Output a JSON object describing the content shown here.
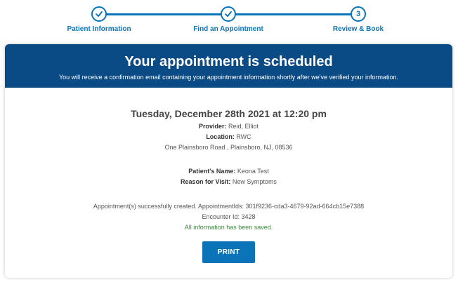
{
  "stepper": {
    "steps": [
      {
        "label": "Patient Information",
        "marker": "✓",
        "state": "complete"
      },
      {
        "label": "Find an Appointment",
        "marker": "✓",
        "state": "complete"
      },
      {
        "label": "Review & Book",
        "marker": "3",
        "state": "current"
      }
    ],
    "accent_color": "#0b74b8"
  },
  "header": {
    "title": "Your appointment is scheduled",
    "subtitle": "You will receive a confirmation email containing your appointment information shortly after we've verified your information.",
    "background_color": "#0a4a85"
  },
  "appointment": {
    "datetime": "Tuesday, December 28th 2021 at 12:20 pm",
    "provider_label": "Provider:",
    "provider": "Reid, Elliot",
    "location_label": "Location:",
    "location": "RWC",
    "address": "One Plainsboro Road , Plainsboro, NJ, 08536",
    "patient_label": "Patient's Name:",
    "patient": "Keona Test",
    "reason_label": "Reason for Visit:",
    "reason": "New Symptoms",
    "status_line": "Appointment(s) successfully created. AppointmentIds: 301f9236-cda3-4679-92ad-664cb15e7388",
    "encounter_line": "Encounter Id: 3428",
    "saved_line": "All information has been saved."
  },
  "actions": {
    "print_label": "PRINT"
  }
}
